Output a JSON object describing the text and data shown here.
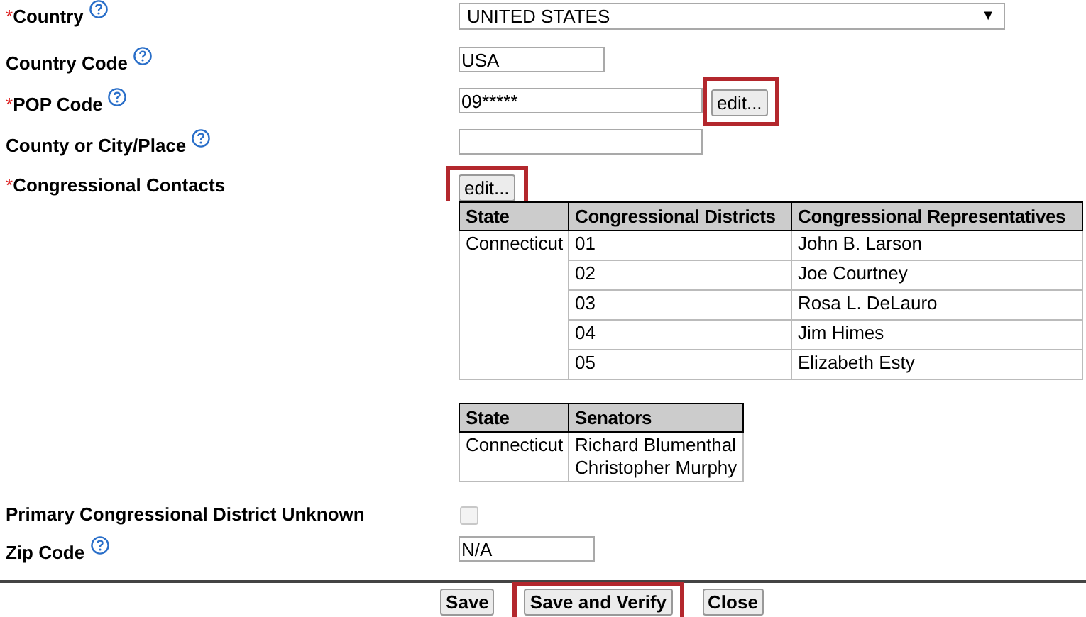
{
  "fields": [
    {
      "kind": "select",
      "label": "Country",
      "required_mark": "*",
      "help": true,
      "value": "UNITED STATES",
      "arrow": "▼"
    },
    {
      "kind": "text",
      "label": "Country Code",
      "help": true,
      "value": "USA"
    },
    {
      "kind": "text",
      "label": "POP Code",
      "required_mark": "*",
      "help": true,
      "value": "09*****",
      "button": {
        "label": "edit...",
        "highlighted": true
      }
    },
    {
      "kind": "text",
      "label": "County or City/Place",
      "help": true
    },
    {
      "kind": "contacts",
      "label": "Congressional Contacts",
      "required_mark": "*",
      "button": {
        "label": "edit...",
        "highlighted": true
      },
      "representatives_table": {
        "columns": [
          "State",
          "Congressional Districts",
          "Congressional Representatives"
        ],
        "rows": [
          {
            "state": "Connecticut",
            "entries": [
              {
                "district": "01",
                "representative": "John B. Larson"
              },
              {
                "district": "02",
                "representative": "Joe Courtney"
              },
              {
                "district": "03",
                "representative": "Rosa L. DeLauro"
              },
              {
                "district": "04",
                "representative": "Jim Himes"
              },
              {
                "district": "05",
                "representative": "Elizabeth Esty"
              }
            ]
          }
        ]
      },
      "senators_table": {
        "columns": [
          "State",
          "Senators"
        ],
        "rows": [
          {
            "state": "Connecticut",
            "senators": [
              "Richard Blumenthal",
              "Christopher Murphy"
            ]
          }
        ]
      }
    },
    {
      "kind": "checkbox",
      "label": "Primary Congressional District Unknown",
      "checked": false,
      "disabled": true
    },
    {
      "kind": "text",
      "label": "Zip Code",
      "help": true,
      "value": "N/A"
    }
  ],
  "buttons": [
    {
      "label": "Save",
      "highlighted": false
    },
    {
      "label": "Save and Verify",
      "highlighted": true
    },
    {
      "label": "Close",
      "highlighted": false
    }
  ]
}
